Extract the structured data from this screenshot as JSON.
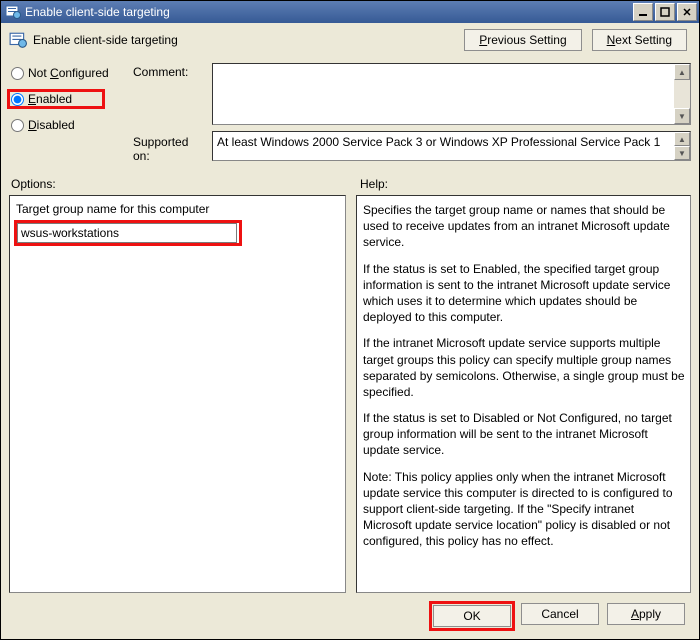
{
  "titlebar": {
    "title": "Enable client-side targeting"
  },
  "header": {
    "policy_name": "Enable client-side targeting",
    "prev_label_pre": "P",
    "prev_label_post": "revious Setting",
    "next_label_pre": "N",
    "next_label_post": "ext Setting"
  },
  "state": {
    "not_configured_label_pre": "Not ",
    "not_configured_label_ul": "C",
    "not_configured_label_post": "onfigured",
    "enabled_label_ul": "E",
    "enabled_label_post": "nabled",
    "disabled_label_ul": "D",
    "disabled_label_post": "isabled",
    "selected": "enabled"
  },
  "comment": {
    "label": "Comment:",
    "value": ""
  },
  "supported": {
    "label": "Supported on:",
    "value": "At least Windows 2000 Service Pack 3 or Windows XP Professional Service Pack 1"
  },
  "labels": {
    "options": "Options:",
    "help": "Help:"
  },
  "options": {
    "target_group_label": "Target group name for this computer",
    "target_group_value": "wsus-workstations"
  },
  "help": {
    "p1": "Specifies the target group name or names that should be used to receive updates from an intranet Microsoft update service.",
    "p2": "If the status is set to Enabled, the specified target group information is sent to the intranet Microsoft update service which uses it to determine which updates should be deployed to this computer.",
    "p3": "If the intranet Microsoft update service supports multiple target groups this policy can specify multiple group names separated by semicolons. Otherwise, a single group must be specified.",
    "p4": "If the status is set to Disabled or Not Configured, no target group information will be sent to the intranet Microsoft update service.",
    "p5": "Note: This policy applies only when the intranet Microsoft update service this computer is directed to is configured to support client-side targeting. If the \"Specify intranet Microsoft update service location\" policy is disabled or not configured, this policy has no effect."
  },
  "footer": {
    "ok": "OK",
    "cancel": "Cancel",
    "apply_ul": "A",
    "apply_post": "pply"
  }
}
